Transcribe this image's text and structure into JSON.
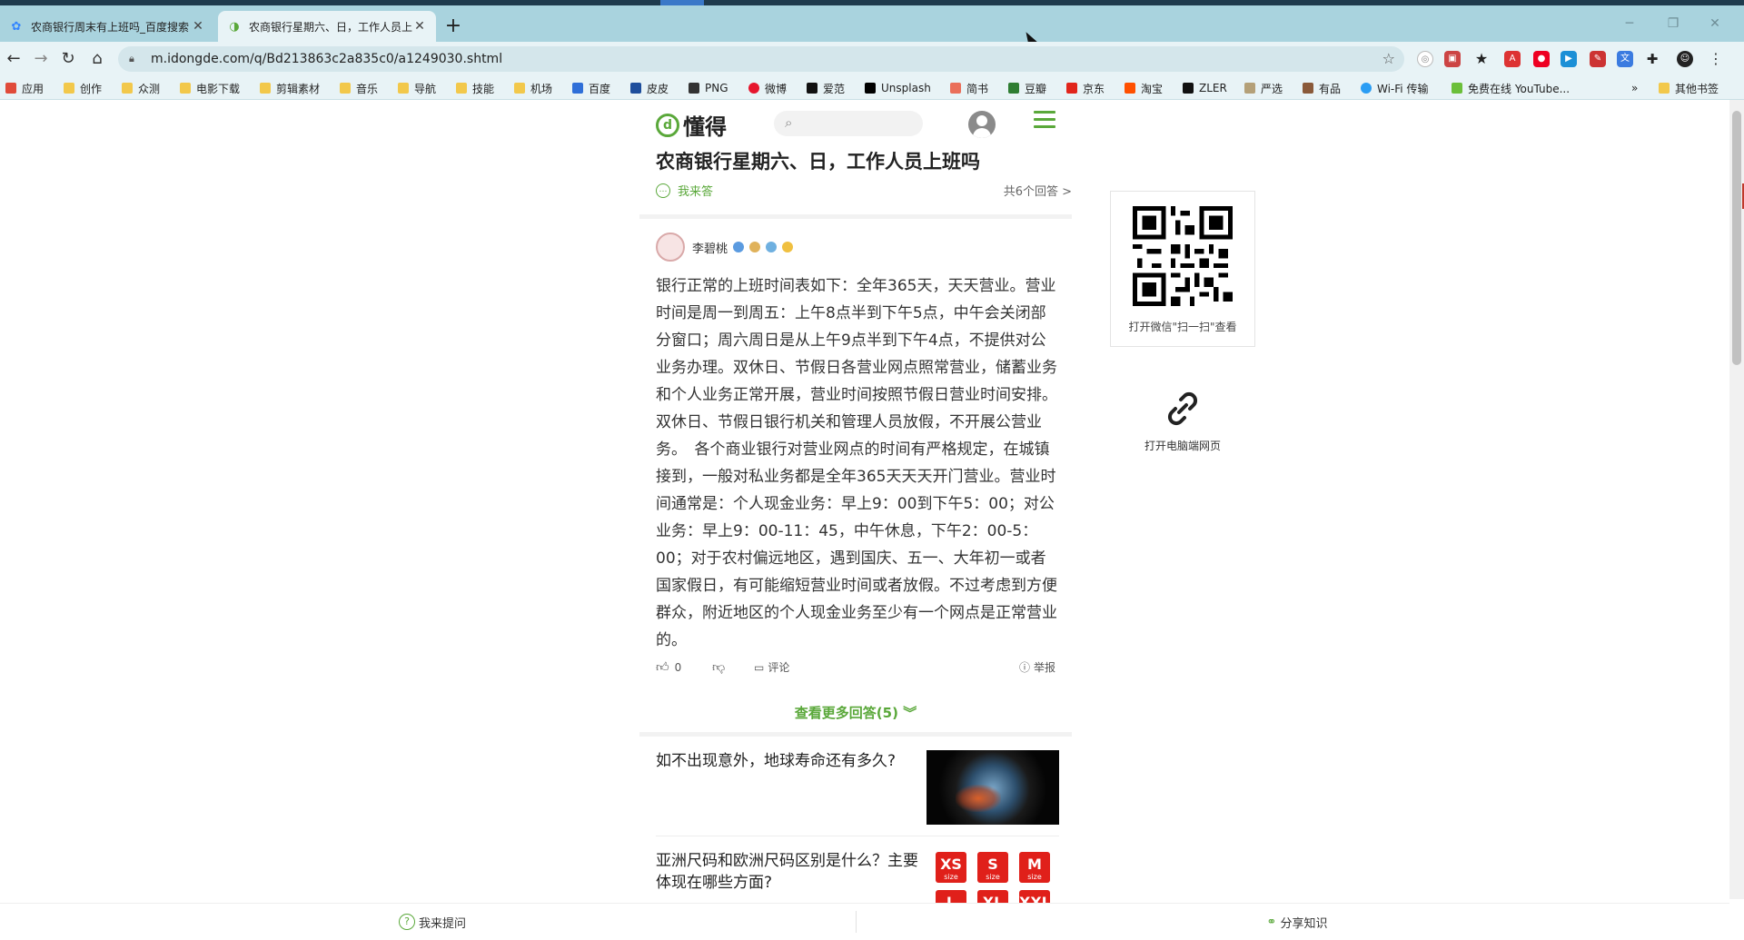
{
  "browser": {
    "tabs": [
      {
        "title": "农商银行周末有上班吗_百度搜索",
        "active": false
      },
      {
        "title": "农商银行星期六、日，工作人员上班吗",
        "active": true
      }
    ],
    "new_tab": "+",
    "url": "m.idongde.com/q/Bd213863c2a835c0/a1249030.shtml",
    "bookmarks": [
      {
        "label": "应用",
        "icon": "apps-grid-icon"
      },
      {
        "label": "创作",
        "icon": "folder-icon"
      },
      {
        "label": "众测",
        "icon": "folder-icon"
      },
      {
        "label": "电影下载",
        "icon": "folder-icon"
      },
      {
        "label": "剪辑素材",
        "icon": "folder-icon"
      },
      {
        "label": "音乐",
        "icon": "folder-icon"
      },
      {
        "label": "导航",
        "icon": "folder-icon"
      },
      {
        "label": "技能",
        "icon": "folder-icon"
      },
      {
        "label": "机场",
        "icon": "folder-icon"
      },
      {
        "label": "百度",
        "icon": "baidu-icon"
      },
      {
        "label": "皮皮",
        "icon": "pipi-icon"
      },
      {
        "label": "PNG",
        "icon": "png-icon"
      },
      {
        "label": "微博",
        "icon": "weibo-icon"
      },
      {
        "label": "爱范",
        "icon": "ifanr-icon"
      },
      {
        "label": "Unsplash",
        "icon": "unsplash-icon"
      },
      {
        "label": "简书",
        "icon": "jianshu-icon"
      },
      {
        "label": "豆瓣",
        "icon": "douban-icon"
      },
      {
        "label": "京东",
        "icon": "jd-icon"
      },
      {
        "label": "淘宝",
        "icon": "taobao-icon"
      },
      {
        "label": "ZLER",
        "icon": "zler-icon"
      },
      {
        "label": "严选",
        "icon": "yanxuan-icon"
      },
      {
        "label": "有品",
        "icon": "youpin-icon"
      },
      {
        "label": "Wi-Fi 传输",
        "icon": "wifi-icon"
      },
      {
        "label": "免费在线 YouTube...",
        "icon": "download-icon"
      }
    ],
    "bookmarks_overflow": "»",
    "other_bookmarks": "其他书签"
  },
  "site": {
    "logo_text": "懂得",
    "search_placeholder": ""
  },
  "question": {
    "title": "农商银行星期六、日，工作人员上班吗",
    "answer_link": "我来答",
    "total_answers": "共6个回答 >"
  },
  "answer": {
    "author": "李碧桃",
    "text": "银行正常的上班时间表如下：全年365天，天天营业。营业时间是周一到周五：上午8点半到下午5点，中午会关闭部分窗口；周六周日是从上午9点半到下午4点，不提供对公业务办理。双休日、节假日各营业网点照常营业，储蓄业务和个人业务正常开展，营业时间按照节假日营业时间安排。双休日、节假日银行机关和管理人员放假，不开展公营业务。　各个商业银行对营业网点的时间有严格规定，在城镇接到，一般对私业务都是全年365天天天开门营业。营业时间通常是：个人现金业务：早上9：00到下午5：00；对公业务：早上9：00-11：45，中午休息，下午2：00-5：00；对于农村偏远地区，遇到国庆、五一、大年初一或者国家假日，有可能缩短营业时间或者放假。不过考虑到方便群众，附近地区的个人现金业务至少有一个网点是正常营业的。",
    "likes": "0",
    "comment_label": "评论",
    "report_label": "举报"
  },
  "more_answers": "查看更多回答(5)",
  "related": [
    {
      "title": "如不出现意外，地球寿命还有多久?"
    },
    {
      "title": "亚洲尺码和欧洲尺码区别是什么？主要体现在哪些方面?"
    }
  ],
  "size_tags": [
    "XS",
    "S",
    "M",
    "L",
    "XL",
    "XXL"
  ],
  "size_sub": "size",
  "sidebar": {
    "qr_caption": "打开微信\"扫一扫\"查看",
    "pc_caption": "打开电脑端网页"
  },
  "bottom": {
    "ask": "我来提问",
    "share": "分享知识"
  }
}
